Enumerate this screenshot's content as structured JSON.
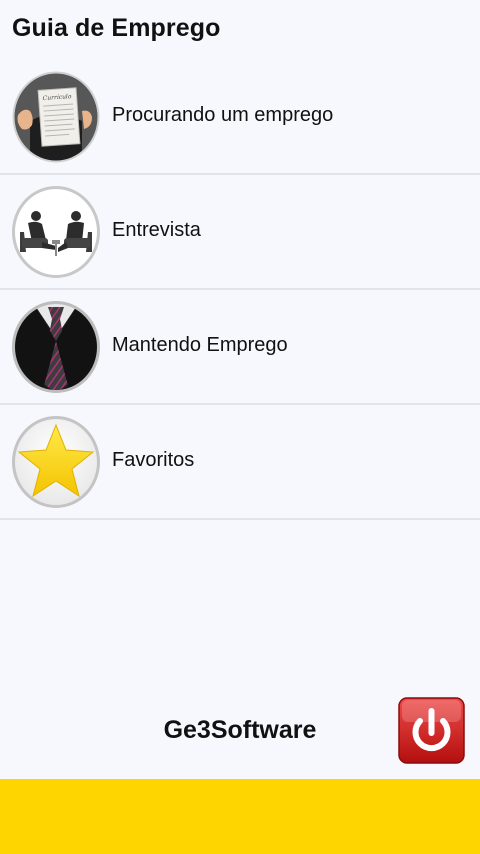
{
  "header": {
    "title": "Guia de Emprego"
  },
  "menu": {
    "items": [
      {
        "label": "Procurando um emprego",
        "icon": "resume-document-icon"
      },
      {
        "label": "Entrevista",
        "icon": "interview-icon"
      },
      {
        "label": "Mantendo Emprego",
        "icon": "tie-icon"
      },
      {
        "label": "Favoritos",
        "icon": "star-icon"
      }
    ]
  },
  "footer": {
    "brand": "Ge3Software",
    "power_icon": "power-icon"
  },
  "colors": {
    "background": "#f7f8fd",
    "divider": "#e3e4ea",
    "banner": "#ffd500",
    "power_red": "#d81d1d",
    "star": "#ffd700"
  },
  "thumb_texts": {
    "resume": "Currículo"
  }
}
